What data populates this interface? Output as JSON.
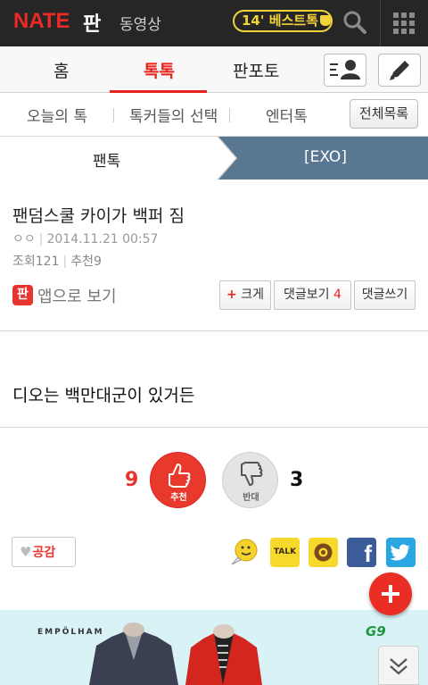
{
  "header": {
    "logo": "NATE",
    "pan": "판",
    "video": "동영상",
    "best_badge": "14' 베스트톡"
  },
  "tabs": [
    {
      "label": "홈"
    },
    {
      "label": "톡톡"
    },
    {
      "label": "판포토"
    }
  ],
  "submenu": {
    "items": [
      "오늘의 톡",
      "톡커들의 선택",
      "엔터톡"
    ],
    "all_button": "전체목록"
  },
  "breadcrumb": {
    "category": "팬톡",
    "sub": "[EXO]"
  },
  "post": {
    "title": "팬덤스쿨 카이가 백퍼 짐",
    "author": "ㅇㅇ",
    "date": "2014.11.21 00:57",
    "views": "조회121",
    "recommends": "추천9",
    "app_view": "앱으로 보기",
    "app_icon": "판",
    "btn_big": "크게",
    "btn_comments": "댓글보기",
    "comment_count": "4",
    "btn_write_comment": "댓글쓰기",
    "body": "디오는 백만대군이 있거든"
  },
  "votes": {
    "up_count": "9",
    "up_label": "추천",
    "down_label": "반대",
    "down_count": "3"
  },
  "share": {
    "empathy": "공감",
    "talk_label": "TALK",
    "fb_label": "f"
  },
  "ad": {
    "brand": "EMPÖLHAM",
    "logo": "G9"
  },
  "colors": {
    "accent": "#e8221c",
    "topbar": "#262626",
    "crumb_active": "#5a7791"
  }
}
